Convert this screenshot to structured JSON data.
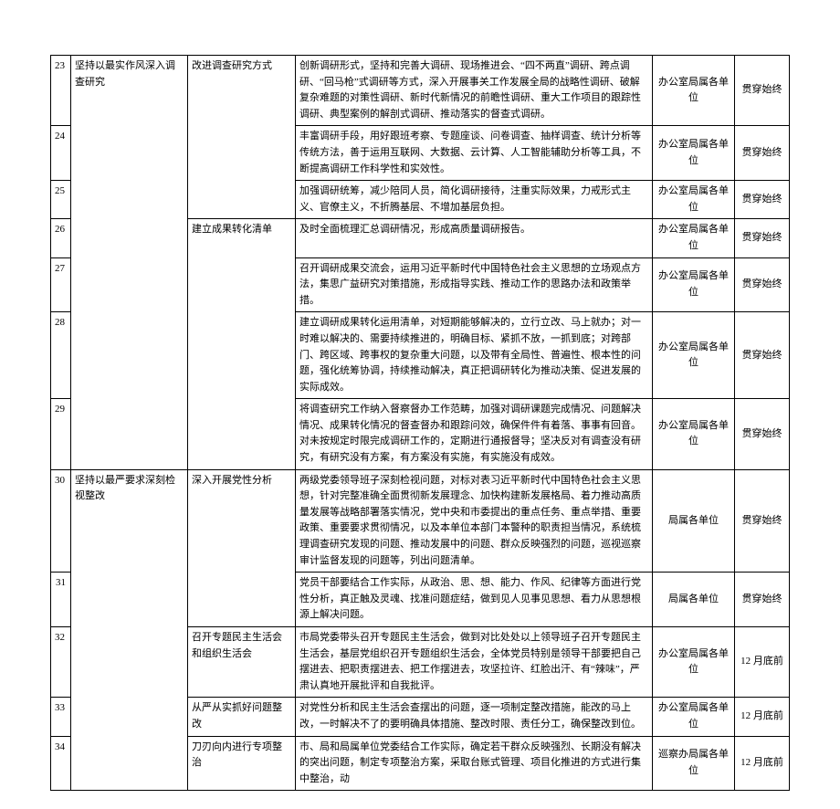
{
  "rows": [
    {
      "id": "23",
      "cat": "坚持以最实作风深入调查研究",
      "meas": "改进调查研究方式",
      "desc": "创新调研形式，坚持和完善大调研、现场推进会、“四不两直”调研、跨点调研、“回马枪”式调研等方式，深入开展事关工作发展全局的战略性调研、破解复杂难题的对策性调研、新时代新情况的前瞻性调研、重大工作项目的跟踪性调研、典型案例的解剖式调研、推动落实的督查式调研。",
      "dept": "办公室局属各单位",
      "time": "贯穿始终",
      "idclass": ""
    },
    {
      "id": "24",
      "desc": "丰富调研手段，用好跟班考察、专题座谈、问卷调查、抽样调查、统计分析等传统方法，善于运用互联网、大数据、云计算、人工智能辅助分析等工具，不断提高调研工作科学性和实效性。",
      "dept": "办公室局属各单位",
      "time": "贯穿始终",
      "idclass": ""
    },
    {
      "id": "25",
      "desc": "加强调研统筹，减少陪同人员，简化调研接待，注重实际效果，力戒形式主义、官僚主义，不折腾基层、不增加基层负担。",
      "dept": "办公室局属各单位",
      "time": "贯穿始终",
      "idclass": ""
    },
    {
      "id": "26",
      "meas": "建立成果转化清单",
      "desc": "及时全面梳理汇总调研情况，形成高质量调研报告。",
      "dept": "办公室局属各单位",
      "time": "贯穿始终",
      "idclass": ""
    },
    {
      "id": "27",
      "desc": "召开调研成果交流会，运用习近平新时代中国特色社会主义思想的立场观点方法，集思广益研究对策措施，形成指导实践、推动工作的思路办法和政策举措。",
      "dept": "办公室局属各单位",
      "time": "贯穿始终",
      "idclass": ""
    },
    {
      "id": "28",
      "desc": "建立调研成果转化运用清单，对短期能够解决的，立行立改、马上就办；对一时难以解决的、需要持续推进的，明确目标、紧抓不放，一抓到底；对跨部门、跨区域、跨事权的复杂重大问题，以及带有全局性、普遍性、根本性的问题，强化统筹协调，持续推动解决，真正把调研转化为推动决策、促进发展的实际成效。",
      "dept": "办公室局属各单位",
      "time": "贯穿始终",
      "idclass": ""
    },
    {
      "id": "29",
      "desc": "将调查研究工作纳入督察督办工作范畴，加强对调研课题完成情况、问题解决情况、成果转化情况的督查督办和跟踪问效，确保件件有着落、事事有回音。对未按规定时限完成调研工作的，定期进行通报督导；坚决反对有调查没有研究，有研究没有方案，有方案没有实施，有实施没有成效。",
      "dept": "办公室局属各单位",
      "time": "贯穿始终",
      "idclass": ""
    },
    {
      "id": "30",
      "cat": "坚持以最严要求深刻检视整改",
      "meas": "深入开展党性分析",
      "desc": "两级党委领导班子深刻检视问题，对标对表习近平新时代中国特色社会主义思想，针对完整准确全面贯彻新发展理念、加快构建新发展格局、着力推动高质量发展等战略部署落实情况，党中央和市委提出的重点任务、重点举措、重要政策、重要要求贯彻情况，以及本单位本部门本警种的职责担当情况，系统梳理调查研究发现的问题、推动发展中的问题、群众反映强烈的问题，巡视巡察审计监督发现的问题等，列出问题清单。",
      "dept": "局属各单位",
      "time": "贯穿始终",
      "idclass": ""
    },
    {
      "id": "31",
      "desc": "党员干部要结合工作实际，从政治、思、想、能力、作风、纪律等方面进行党性分析，真正触及灵魂、找准问题症结，做到见人见事见思想、看力从思想根源上解决问题。",
      "dept": "局属各单位",
      "time": "贯穿始终",
      "idclass": "id-indent"
    },
    {
      "id": "32",
      "meas": "召开专题民主生活会和组织生活会",
      "desc": "市局党委带头召开专题民主生活会，做到对比处处以上领导班子召开专题民主生活会，基层党组织召开专题组织生活会，全体党员特别是领导干部要把自己摆进去、把职责摆进去、把工作摆进去，攻坚拉许、红脸出汗、有“辣味”，严肃认真地开展批评和自我批评。",
      "dept": "办公室局属各单位",
      "time": "12 月底前",
      "idclass": ""
    },
    {
      "id": "33",
      "meas": "从严从实抓好问题整改",
      "desc": "对党性分析和民主生活会查摆出的问题，逐一项制定整改措施，能改的马上改，一时解决不了的要明确具体措施、整改时限、责任分工，确保整改到位。",
      "dept": "办公室局属各单位",
      "time": "12 月底前",
      "idclass": ""
    },
    {
      "id": "34",
      "meas": "刀刃向内进行专项整治",
      "desc": "市、局和局属单位党委结合工作实际，确定若干群众反映强烈、长期没有解决的突出问题，制定专项整治方案，采取台账式管理、项目化推进的方式进行集中整治，动",
      "dept": "巡察办局属各单位",
      "time": "12 月底前",
      "idclass": ""
    }
  ]
}
